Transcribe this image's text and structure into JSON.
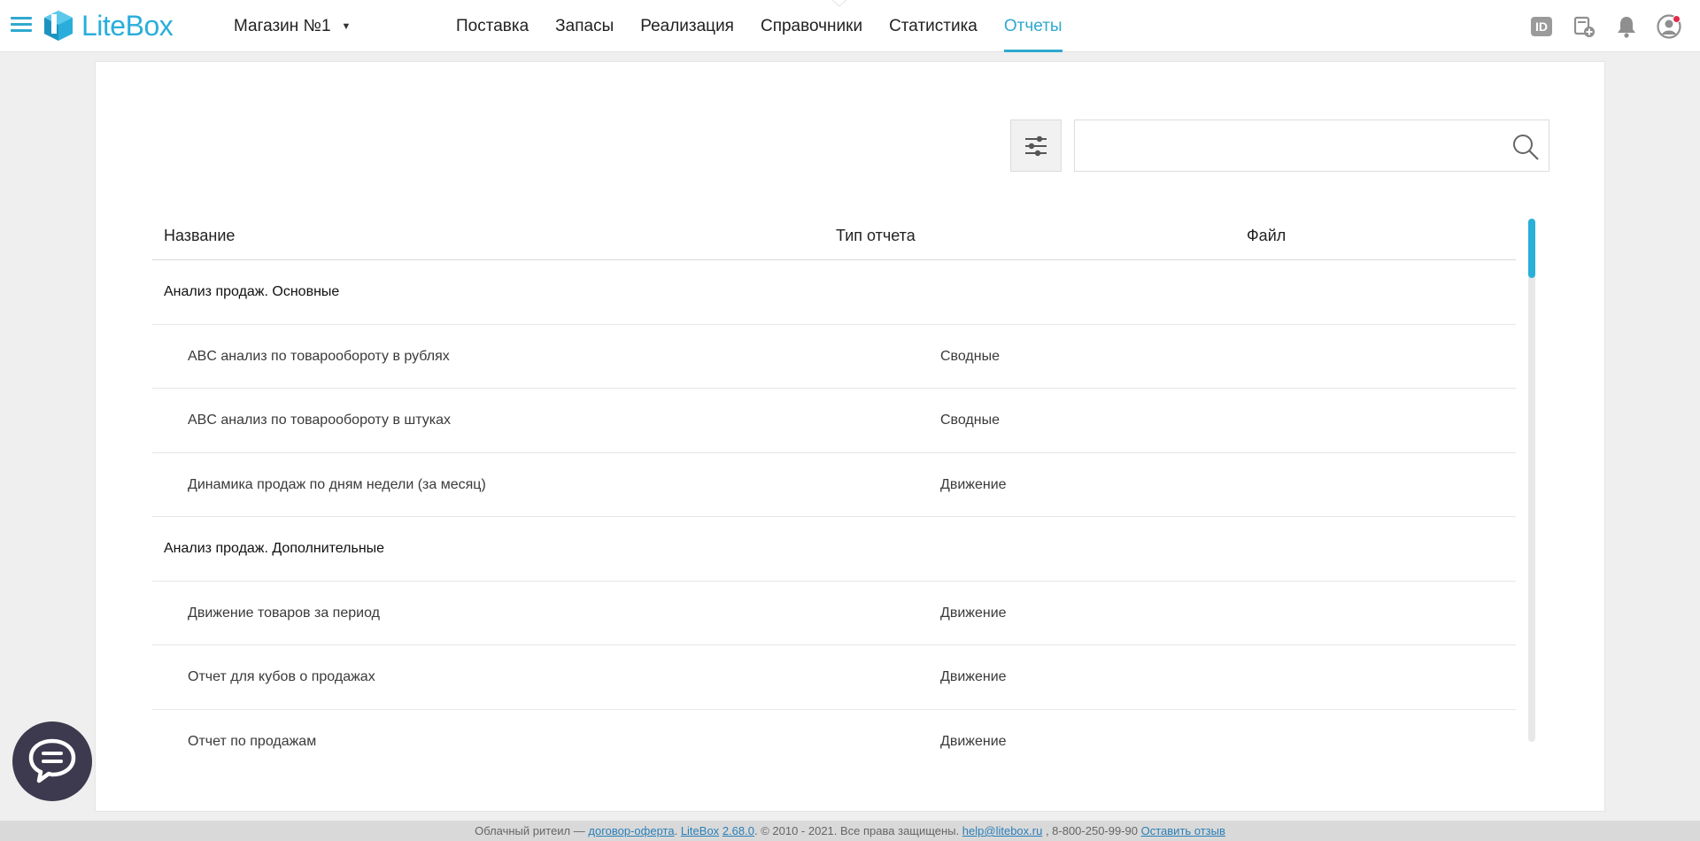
{
  "header": {
    "logo_text": "LiteBox",
    "store_name": "Магазин №1",
    "nav": [
      {
        "label": "Поставка"
      },
      {
        "label": "Запасы"
      },
      {
        "label": "Реализация"
      },
      {
        "label": "Справочники"
      },
      {
        "label": "Статистика"
      },
      {
        "label": "Отчеты",
        "active": true
      }
    ],
    "id_badge": "ID",
    "icons": [
      "id-icon",
      "add-document-icon",
      "bell-icon",
      "user-avatar-icon"
    ]
  },
  "toolbar": {
    "search_value": "",
    "search_placeholder": ""
  },
  "table": {
    "columns": [
      "Название",
      "Тип отчета",
      "Файл"
    ],
    "rows": [
      {
        "kind": "group",
        "name": "Анализ продаж. Основные"
      },
      {
        "kind": "item",
        "name": "ABC анализ по товарообороту в рублях",
        "type": "Сводные",
        "file": ""
      },
      {
        "kind": "item",
        "name": "ABC анализ по товарообороту в штуках",
        "type": "Сводные",
        "file": ""
      },
      {
        "kind": "item",
        "name": "Динамика продаж по дням недели (за месяц)",
        "type": "Движение",
        "file": ""
      },
      {
        "kind": "group",
        "name": "Анализ продаж. Дополнительные"
      },
      {
        "kind": "item",
        "name": "Движение товаров за период",
        "type": "Движение",
        "file": ""
      },
      {
        "kind": "item",
        "name": "Отчет для кубов о продажах",
        "type": "Движение",
        "file": ""
      },
      {
        "kind": "item",
        "name": "Отчет по продажам",
        "type": "Движение",
        "file": ""
      }
    ]
  },
  "footer": {
    "text1": "Облачный ритеил — ",
    "offer_link": "договор-оферта",
    "sep1": ". ",
    "brand_link": "LiteBox",
    "sep2": " ",
    "version_link": "2.68.0",
    "text2": ". © 2010 - 2021. Все права защищены. ",
    "email_link": "help@litebox.ru",
    "text3": " , 8-800-250-99-90 ",
    "feedback_link": "Оставить отзыв"
  },
  "colors": {
    "accent": "#2fa9cf",
    "chat_bubble": "#3d3a4f",
    "notification_dot": "#e02b48"
  }
}
